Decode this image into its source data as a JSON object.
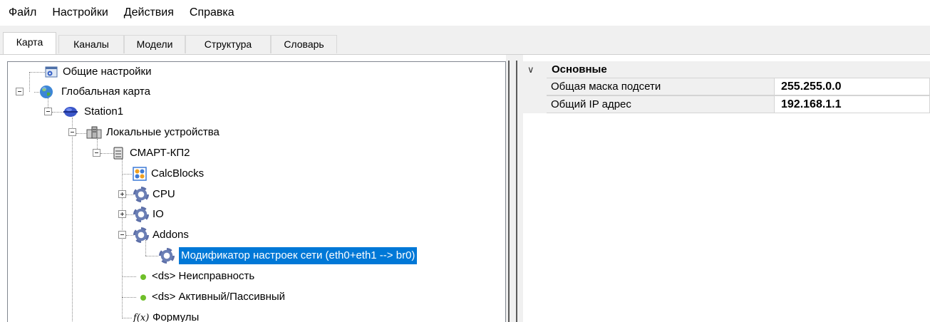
{
  "menu": [
    "Файл",
    "Настройки",
    "Действия",
    "Справка"
  ],
  "tabs": [
    "Карта",
    "Каналы",
    "Модели",
    "Структура",
    "Словарь"
  ],
  "active_tab": "Карта",
  "tree": {
    "general": "Общие настройки",
    "global_map": "Глобальная карта",
    "station": "Station1",
    "local_devices": "Локальные устройства",
    "device": "СМАРТ-КП2",
    "calcblocks": "CalcBlocks",
    "cpu": "CPU",
    "io": "IO",
    "addons": "Addons",
    "modifier": "Модификатор настроек сети (eth0+eth1 --> br0)",
    "ds_fault": "<ds> Неисправность",
    "ds_active": "<ds> Активный/Пассивный",
    "formulas": "Формулы"
  },
  "properties": {
    "group": "Основные",
    "rows": [
      {
        "name": "Общая маска подсети",
        "value": "255.255.0.0"
      },
      {
        "name": "Общий IP адрес",
        "value": "192.168.1.1"
      }
    ]
  },
  "colors": {
    "selection": "#0078d7",
    "panel_bg": "#f0f0f0",
    "status_dot": "#6fbf2a",
    "gear": "#5d6fa8"
  }
}
